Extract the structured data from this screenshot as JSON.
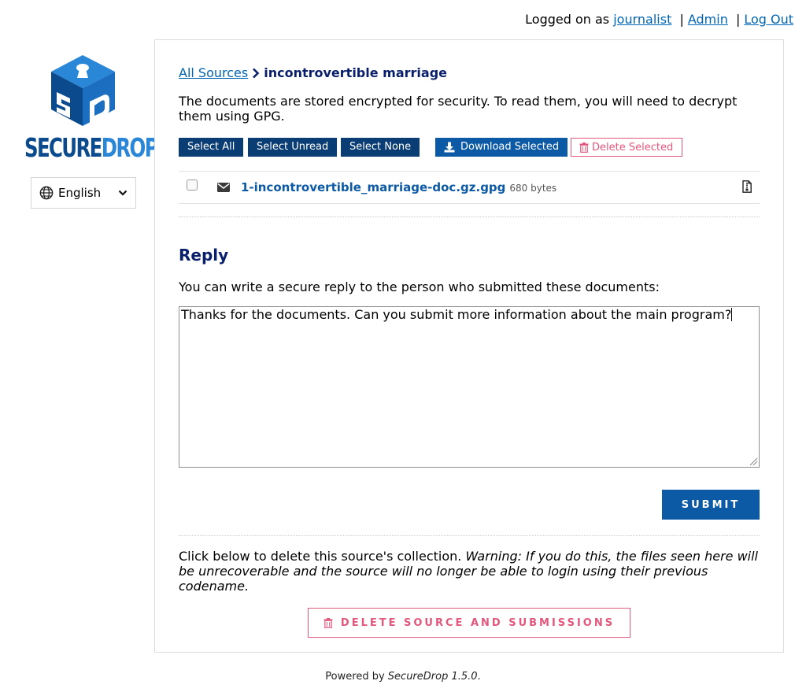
{
  "header": {
    "logged_prefix": "Logged on as",
    "username": "journalist",
    "separator": "|",
    "admin_label": "Admin",
    "logout_label": "Log Out"
  },
  "brand": {
    "word1": "SECURE",
    "word2": "DROP",
    "colors": {
      "dark": "#0b4a8c",
      "light": "#2a87d8"
    }
  },
  "language": {
    "selected": "English"
  },
  "breadcrumb": {
    "root_label": "All Sources",
    "current": "incontrovertible marriage"
  },
  "intro_text": "The documents are stored encrypted for security. To read them, you will need to decrypt them using GPG.",
  "actions": {
    "select_all": "Select All",
    "select_unread": "Select Unread",
    "select_none": "Select None",
    "download_selected": "Download Selected",
    "delete_selected": "Delete Selected"
  },
  "files": [
    {
      "name": "1-incontrovertible_marriage-doc.gz.gpg",
      "size": "680 bytes",
      "checked": false
    }
  ],
  "reply": {
    "title": "Reply",
    "help": "You can write a secure reply to the person who submitted these documents:",
    "text": "Thanks for the documents. Can you submit more information about the main program?",
    "submit": "SUBMIT"
  },
  "delete_source": {
    "text": "Click below to delete this source's collection.",
    "warning": "Warning: If you do this, the files seen here will be unrecoverable and the source will no longer be able to login using their previous codename.",
    "button": "DELETE SOURCE AND SUBMISSIONS"
  },
  "footer": {
    "prefix": "Powered by",
    "product": "SecureDrop 1.5.0",
    "suffix": "."
  },
  "colors": {
    "navy": "#0b3d75",
    "blue": "#0c5aa6",
    "link": "#0065b3",
    "danger": "#e2577c",
    "title": "#0a1f6b"
  }
}
